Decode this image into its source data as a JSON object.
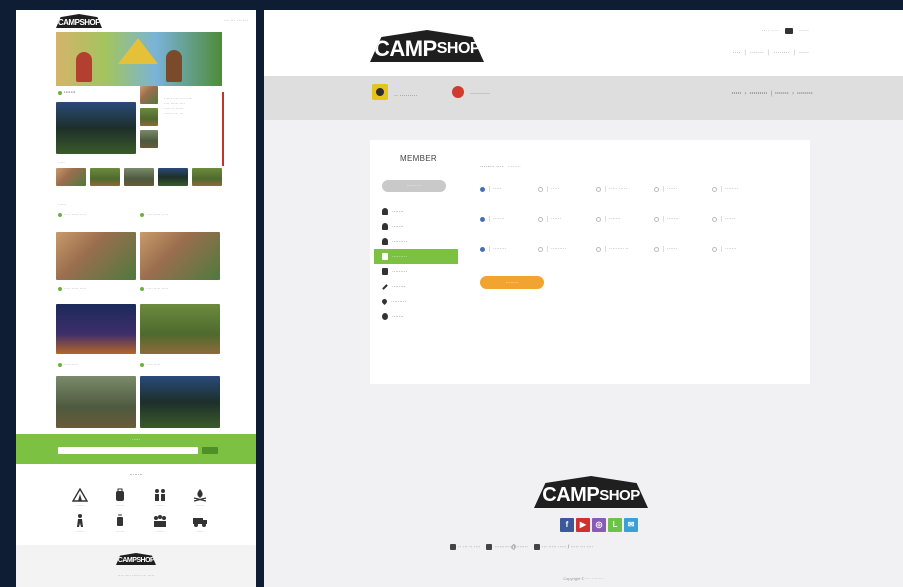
{
  "left_preview": {
    "logo": {
      "main": "CAMP",
      "accent": "SHOP"
    },
    "top_links": "··· ··· ··· ···",
    "sections": {
      "news_label": "·······",
      "gallery_label": "·····",
      "posts_label": "······"
    },
    "green_band_title": "·····",
    "icons_title": "········",
    "icon_labels": [
      "········",
      "·······",
      "········",
      "·······",
      "········",
      "·······",
      "········",
      "······"
    ],
    "footer_text": "···· ····· ······ ···· ·····"
  },
  "header": {
    "logo": {
      "main": "CAMP",
      "accent": "SHOP"
    },
    "utility": [
      "···· ····",
      "·····"
    ],
    "nav": [
      "····",
      "·······",
      "········",
      "·····"
    ],
    "nav_seps": [
      "|",
      "|",
      "|"
    ]
  },
  "subbar": {
    "badge1_text": "·· ·········",
    "badge2_text": "··········",
    "crumbs": [
      "·····",
      "·········",
      "·······",
      "········"
    ],
    "crumb_seps": [
      "›",
      "|",
      "›"
    ]
  },
  "account": {
    "title": "MEMBER",
    "user_button": "·········",
    "menu": [
      {
        "label": "·······",
        "icon": "person-icon",
        "active": false
      },
      {
        "label": "·······",
        "icon": "person-icon",
        "active": false
      },
      {
        "label": "·········",
        "icon": "person-icon",
        "active": false
      },
      {
        "label": "·········",
        "icon": "car-icon",
        "active": true
      },
      {
        "label": "·········",
        "icon": "box-icon",
        "active": false
      },
      {
        "label": "········",
        "icon": "pencil-icon",
        "active": false
      },
      {
        "label": "·········",
        "icon": "pin-icon",
        "active": false
      },
      {
        "label": "·······",
        "icon": "circle-icon",
        "active": false
      }
    ],
    "form_title": "········ ····",
    "form_subtitle": "········",
    "option_rows": [
      [
        "·····",
        "·····",
        "····· ·····",
        "······",
        "········"
      ],
      [
        "·······",
        "······",
        "·······",
        "·······",
        "······"
      ],
      [
        "········",
        "·········",
        "········· ··",
        "······",
        "·······"
      ]
    ],
    "selected": [
      0,
      0,
      0
    ],
    "submit_label": "········"
  },
  "footer": {
    "logo": {
      "main": "CAMP",
      "accent": "SHOP"
    },
    "social": [
      {
        "icon": "facebook-icon",
        "glyph": "f",
        "color": "#3b5998"
      },
      {
        "icon": "youtube-icon",
        "glyph": "▶",
        "color": "#d1302f"
      },
      {
        "icon": "instagram-icon",
        "glyph": "◎",
        "color": "#8a5bb5"
      },
      {
        "icon": "line-icon",
        "glyph": "L",
        "color": "#6cc24a"
      },
      {
        "icon": "share-icon",
        "glyph": "✉",
        "color": "#3aa0d8"
      }
    ],
    "phone": "·· ··· ·· ····",
    "email": "··········@·······",
    "address": "··· ····· ····· / ····· ··· ····",
    "copyright": "Copyright © ···· ·········"
  },
  "colors": {
    "brand_green": "#7cc142",
    "accent_orange": "#f2a431",
    "page_dark": "#0e1d33"
  }
}
